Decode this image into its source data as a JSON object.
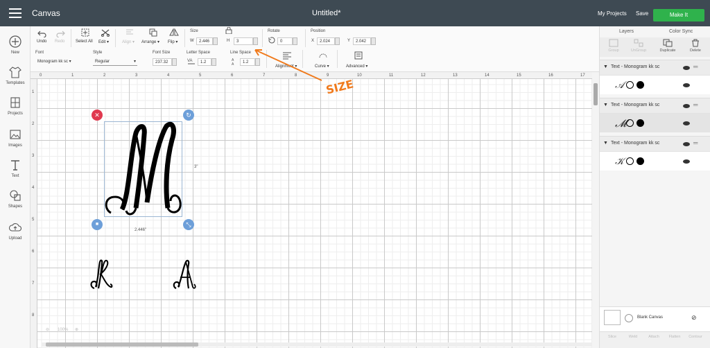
{
  "topbar": {
    "app_title": "Canvas",
    "doc_title": "Untitled*",
    "my_projects": "My Projects",
    "save": "Save",
    "make_it": "Make It"
  },
  "sidebar": {
    "items": [
      {
        "label": "New",
        "icon": "plus-circle-icon"
      },
      {
        "label": "Templates",
        "icon": "shirt-icon"
      },
      {
        "label": "Projects",
        "icon": "projects-icon"
      },
      {
        "label": "Images",
        "icon": "image-icon"
      },
      {
        "label": "Text",
        "icon": "text-icon"
      },
      {
        "label": "Shapes",
        "icon": "shapes-icon"
      },
      {
        "label": "Upload",
        "icon": "upload-cloud-icon"
      }
    ]
  },
  "toolbar": {
    "undo": "Undo",
    "redo": "Redo",
    "select_all": "Select All",
    "edit": "Edit",
    "align": "Align",
    "arrange": "Arrange",
    "flip": "Flip",
    "size_label": "Size",
    "w_label": "W",
    "w_value": "2.446",
    "h_label": "H",
    "h_value": "3",
    "rotate_label": "Rotate",
    "rotate_value": "0",
    "position_label": "Position",
    "x_label": "X",
    "x_value": "2.024",
    "y_label": "Y",
    "y_value": "2.042",
    "font_label": "Font",
    "font_value": "Monogram kk sc",
    "style_label": "Style",
    "style_value": "Regular",
    "font_size_label": "Font Size",
    "font_size_value": "237.32",
    "letter_space_label": "Letter Space",
    "letter_space_value": "1.2",
    "line_space_label": "Line Space",
    "line_space_value": "1.2",
    "alignment": "Alignment",
    "curve": "Curve",
    "advanced": "Advanced"
  },
  "ruler": {
    "top": [
      "0",
      "1",
      "2",
      "3",
      "4",
      "5",
      "6",
      "7",
      "8",
      "9",
      "10",
      "11",
      "12",
      "13",
      "14",
      "15",
      "16",
      "17"
    ],
    "left": [
      "1",
      "2",
      "3",
      "4",
      "5",
      "6",
      "7",
      "8"
    ]
  },
  "canvas": {
    "height_label": "3\"",
    "width_label": "2.446\"",
    "zoom": "100%",
    "annotation": "SIZE"
  },
  "layers_panel": {
    "tabs": [
      "Layers",
      "Color Sync"
    ],
    "tools": [
      "Group",
      "UnGroup",
      "Duplicate",
      "Delete"
    ],
    "groups": [
      {
        "name": "Text - Monogram kk sc"
      },
      {
        "name": "Text - Monogram kk sc"
      },
      {
        "name": "Text - Monogram kk sc"
      }
    ],
    "blank_canvas": "Blank Canvas",
    "footer_tools": [
      "Slice",
      "Weld",
      "Attach",
      "Flatten",
      "Contour"
    ]
  },
  "colors": {
    "topbar": "#3e4a53",
    "make_it": "#2fb24c",
    "annotation": "#f07a1c",
    "delete_handle": "#e0394f",
    "blue_handle": "#6d9fd9"
  }
}
